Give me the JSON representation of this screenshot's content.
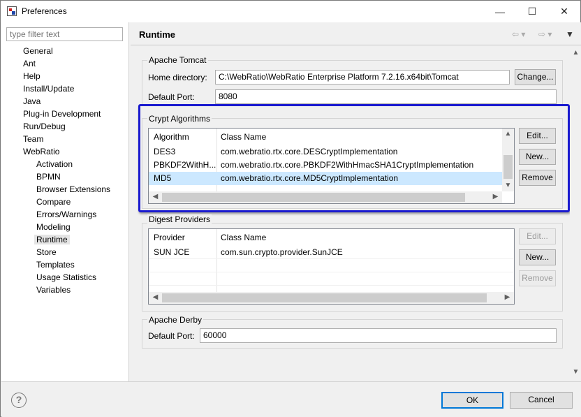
{
  "window": {
    "title": "Preferences"
  },
  "filter": {
    "placeholder": "type filter text"
  },
  "tree": [
    {
      "label": "General",
      "level": 0
    },
    {
      "label": "Ant",
      "level": 0
    },
    {
      "label": "Help",
      "level": 0
    },
    {
      "label": "Install/Update",
      "level": 0
    },
    {
      "label": "Java",
      "level": 0
    },
    {
      "label": "Plug-in Development",
      "level": 0
    },
    {
      "label": "Run/Debug",
      "level": 0
    },
    {
      "label": "Team",
      "level": 0
    },
    {
      "label": "WebRatio",
      "level": 0
    },
    {
      "label": "Activation",
      "level": 1
    },
    {
      "label": "BPMN",
      "level": 1
    },
    {
      "label": "Browser Extensions",
      "level": 1
    },
    {
      "label": "Compare",
      "level": 1
    },
    {
      "label": "Errors/Warnings",
      "level": 1
    },
    {
      "label": "Modeling",
      "level": 1
    },
    {
      "label": "Runtime",
      "level": 1,
      "selected": true
    },
    {
      "label": "Store",
      "level": 1
    },
    {
      "label": "Templates",
      "level": 1
    },
    {
      "label": "Usage Statistics",
      "level": 1
    },
    {
      "label": "Variables",
      "level": 1
    }
  ],
  "page": {
    "title": "Runtime"
  },
  "tomcat": {
    "group_label": "Apache Tomcat",
    "home_label": "Home directory:",
    "home_value": "C:\\WebRatio\\WebRatio Enterprise Platform 7.2.16.x64bit\\Tomcat",
    "change_label": "Change...",
    "port_label": "Default Port:",
    "port_value": "8080"
  },
  "crypt": {
    "group_label": "Crypt Algorithms",
    "headers": [
      "Algorithm",
      "Class Name"
    ],
    "rows": [
      {
        "algorithm": "DES3",
        "class": "com.webratio.rtx.core.DESCryptImplementation"
      },
      {
        "algorithm": "PBKDF2WithH...",
        "class": "com.webratio.rtx.core.PBKDF2WithHmacSHA1CryptImplementation"
      },
      {
        "algorithm": "MD5",
        "class": "com.webratio.rtx.core.MD5CryptImplementation"
      }
    ],
    "edit_label": "Edit...",
    "new_label": "New...",
    "remove_label": "Remove"
  },
  "digest": {
    "group_label": "Digest Providers",
    "headers": [
      "Provider",
      "Class Name"
    ],
    "rows": [
      {
        "provider": "SUN JCE",
        "class": "com.sun.crypto.provider.SunJCE"
      }
    ],
    "edit_label": "Edit...",
    "new_label": "New...",
    "remove_label": "Remove"
  },
  "derby": {
    "group_label": "Apache Derby",
    "port_label": "Default Port:",
    "port_value": "60000"
  },
  "footer": {
    "ok_label": "OK",
    "cancel_label": "Cancel"
  },
  "icons": {
    "help": "?",
    "minimize": "—",
    "maximize": "☐",
    "close": "✕"
  },
  "colors": {
    "highlight_border": "#1a1acf",
    "selection": "#cce8ff",
    "ok_border": "#0078d7"
  }
}
